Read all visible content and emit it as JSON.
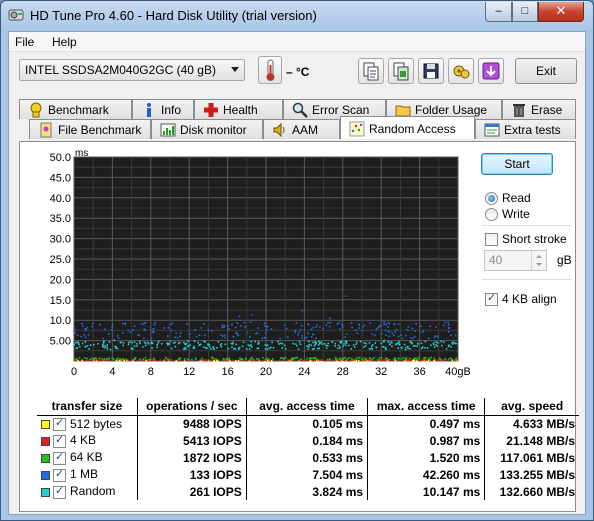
{
  "window": {
    "title": "HD Tune Pro 4.60 - Hard Disk Utility (trial version)",
    "controls": {
      "minimize": "–",
      "maximize": "□",
      "close": "✕"
    }
  },
  "menu": {
    "file": "File",
    "help": "Help"
  },
  "toolbar": {
    "drive": "INTEL SSDSA2M040G2GC (40 gB)",
    "temperature": "– °C",
    "exit_label": "Exit",
    "icons": [
      "copy-text-icon",
      "copy-screenshot-icon",
      "save-icon",
      "options-icon",
      "download-icon"
    ]
  },
  "tabs_row1": [
    {
      "label": "Benchmark",
      "icon": "benchmark-icon"
    },
    {
      "label": "Info",
      "icon": "info-icon"
    },
    {
      "label": "Health",
      "icon": "health-icon"
    },
    {
      "label": "Error Scan",
      "icon": "error-scan-icon"
    },
    {
      "label": "Folder Usage",
      "icon": "folder-icon"
    },
    {
      "label": "Erase",
      "icon": "erase-icon"
    }
  ],
  "tabs_row2": [
    {
      "label": "File Benchmark",
      "icon": "file-benchmark-icon"
    },
    {
      "label": "Disk monitor",
      "icon": "disk-monitor-icon"
    },
    {
      "label": "AAM",
      "icon": "speaker-icon"
    },
    {
      "label": "Random Access",
      "icon": "random-access-icon",
      "active": true
    },
    {
      "label": "Extra tests",
      "icon": "extra-tests-icon"
    }
  ],
  "side": {
    "start_label": "Start",
    "read_label": "Read",
    "write_label": "Write",
    "read_selected": true,
    "short_stroke_label": "Short stroke",
    "short_stroke_checked": false,
    "stroke_value": "40",
    "stroke_unit": "gB",
    "align_label": "4 KB align",
    "align_checked": true
  },
  "chart_data": {
    "type": "scatter",
    "ylabel": "ms",
    "ylim": [
      0,
      50
    ],
    "yticks": [
      "50.0",
      "45.0",
      "40.0",
      "35.0",
      "30.0",
      "25.0",
      "20.0",
      "15.0",
      "10.0",
      "5.00"
    ],
    "xlim": [
      0,
      40
    ],
    "xticks": [
      "0",
      "4",
      "8",
      "12",
      "16",
      "20",
      "24",
      "28",
      "32",
      "36",
      "40gB"
    ],
    "background": "#1e1e1e",
    "grid": true,
    "series": [
      {
        "name": "512 bytes",
        "color": "#ffff00",
        "avg_ms": 0.105,
        "max_ms": 0.497
      },
      {
        "name": "4 KB",
        "color": "#e02020",
        "avg_ms": 0.184,
        "max_ms": 0.987
      },
      {
        "name": "64 KB",
        "color": "#20c020",
        "avg_ms": 0.533,
        "max_ms": 1.52
      },
      {
        "name": "1 MB",
        "color": "#1f6fe0",
        "avg_ms": 7.504,
        "max_ms": 42.26
      },
      {
        "name": "Random",
        "color": "#22d0d0",
        "avg_ms": 3.824,
        "max_ms": 10.147
      }
    ]
  },
  "results": {
    "headers": [
      "transfer size",
      "operations / sec",
      "avg. access time",
      "max. access time",
      "avg. speed"
    ],
    "rows": [
      {
        "size": "512 bytes",
        "color": "#ffff00",
        "ops": "9488 IOPS",
        "avg": "0.105 ms",
        "max": "0.497 ms",
        "speed": "4.633 MB/s"
      },
      {
        "size": "4 KB",
        "color": "#e02020",
        "ops": "5413 IOPS",
        "avg": "0.184 ms",
        "max": "0.987 ms",
        "speed": "21.148 MB/s"
      },
      {
        "size": "64 KB",
        "color": "#20c020",
        "ops": "1872 IOPS",
        "avg": "0.533 ms",
        "max": "1.520 ms",
        "speed": "117.061 MB/s"
      },
      {
        "size": "1 MB",
        "color": "#1f6fe0",
        "ops": "133 IOPS",
        "avg": "7.504 ms",
        "max": "42.260 ms",
        "speed": "133.255 MB/s"
      },
      {
        "size": "Random",
        "color": "#22d0d0",
        "ops": "261 IOPS",
        "avg": "3.824 ms",
        "max": "10.147 ms",
        "speed": "132.660 MB/s"
      }
    ]
  }
}
